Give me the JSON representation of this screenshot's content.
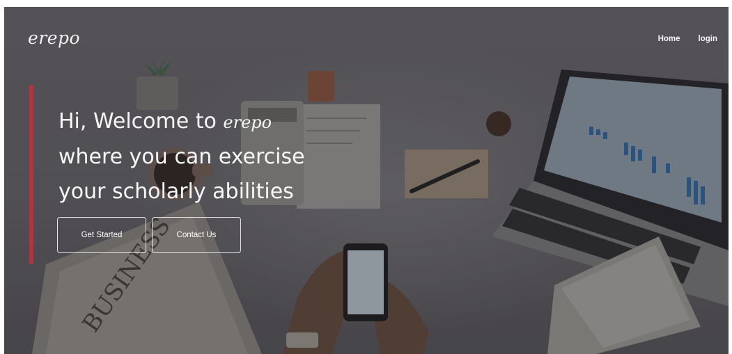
{
  "brand": {
    "name": "erepo"
  },
  "nav": {
    "items": [
      {
        "label": "Home"
      },
      {
        "label": "login"
      }
    ]
  },
  "hero": {
    "line1_prefix": "Hi, Welcome to ",
    "line1_brand": "erepo",
    "line2": "where you can exercise",
    "line3": "your scholarly abilities"
  },
  "buttons": {
    "get_started": "Get Started",
    "contact_us": "Contact Us"
  },
  "background": {
    "newspaper_text": "BUSINESS"
  },
  "colors": {
    "accent": "#b8323b",
    "text": "#f7f7f7",
    "overlay": "#58565a"
  }
}
